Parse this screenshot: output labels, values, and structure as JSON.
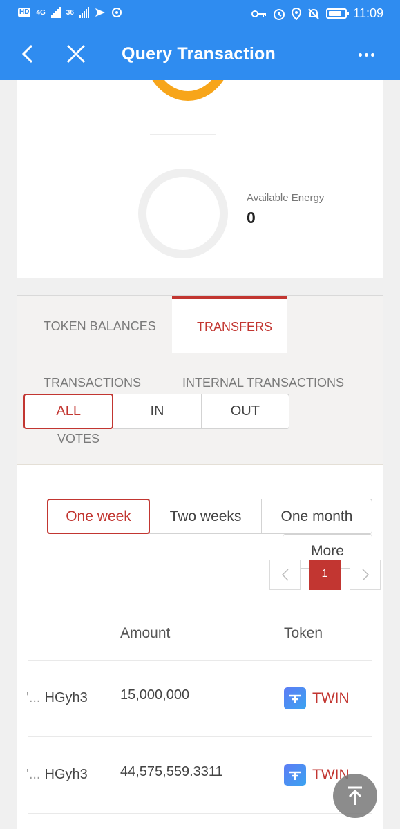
{
  "status_bar": {
    "hd_label": "HD",
    "net1_label": "4G",
    "net2_label": "36",
    "time": "11:09"
  },
  "header": {
    "title": "Query Transaction"
  },
  "resources": {
    "energy_label": "Available Energy",
    "energy_value": "0"
  },
  "tabs": {
    "token_balances": "TOKEN BALANCES",
    "transfers": "TRANSFERS"
  },
  "subtabs": {
    "transactions": "TRANSACTIONS",
    "internal": "INTERNAL TRANSACTIONS",
    "votes": "VOTES"
  },
  "direction_filter": {
    "options": [
      "ALL",
      "IN",
      "OUT"
    ],
    "selected": "ALL"
  },
  "period_filter": {
    "options": [
      "One week",
      "Two weeks",
      "One month"
    ],
    "more": "More",
    "selected": "One week"
  },
  "pagination": {
    "current_page": "1"
  },
  "table": {
    "columns": {
      "amount": "Amount",
      "token": "Token"
    },
    "rows": [
      {
        "from_prefix": "'...",
        "from": "HGyh3",
        "amount": "15,000,000",
        "token": "TWIN"
      },
      {
        "from_prefix": "'...",
        "from": "HGyh3",
        "amount": "44,575,559.3311",
        "token": "TWIN"
      }
    ]
  },
  "colors": {
    "header_blue": "#2f8cf0",
    "accent_red": "#c23631",
    "bandwidth_orange": "#f7a51a"
  },
  "icons": [
    "back-arrow-icon",
    "close-icon",
    "more-dots-icon",
    "key-icon",
    "alarm-icon",
    "location-icon",
    "mute-bell-icon",
    "battery-icon",
    "chevron-left-icon",
    "chevron-right-icon",
    "twin-token-icon",
    "scroll-to-top-icon"
  ]
}
